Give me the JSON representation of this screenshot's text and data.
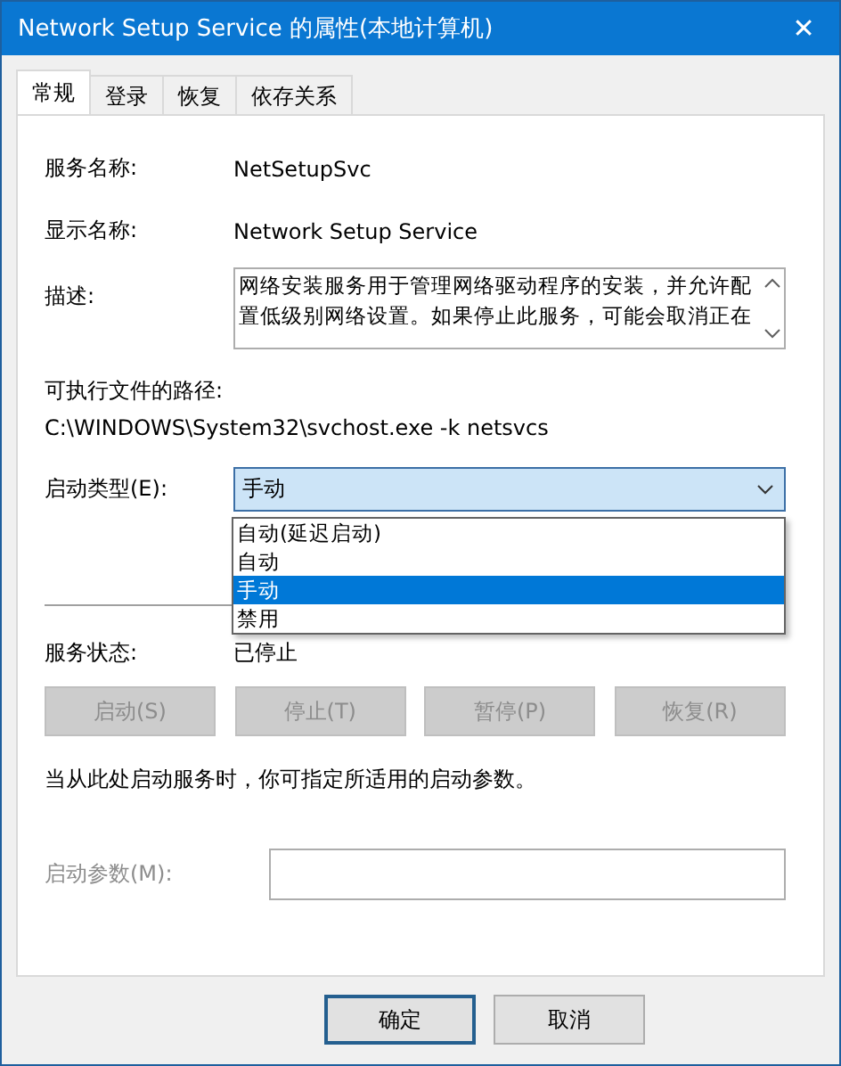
{
  "window": {
    "title": "Network Setup Service 的属性(本地计算机)",
    "close": "✕"
  },
  "tabs": [
    {
      "label": "常规",
      "selected": true
    },
    {
      "label": "登录",
      "selected": false
    },
    {
      "label": "恢复",
      "selected": false
    },
    {
      "label": "依存关系",
      "selected": false
    }
  ],
  "service_name": {
    "label": "服务名称:",
    "value": "NetSetupSvc"
  },
  "display_name": {
    "label": "显示名称:",
    "value": "Network Setup Service"
  },
  "description": {
    "label": "描述:",
    "value": "网络安装服务用于管理网络驱动程序的安装，并允许配置低级别网络设置。如果停止此服务，可能会取消正在"
  },
  "executable_path": {
    "label": "可执行文件的路径:",
    "value": "C:\\WINDOWS\\System32\\svchost.exe -k netsvcs"
  },
  "startup_type": {
    "label": "启动类型(E):",
    "value": "手动",
    "expanded": true,
    "options": [
      {
        "label": "自动(延迟启动)",
        "selected": false
      },
      {
        "label": "自动",
        "selected": false
      },
      {
        "label": "手动",
        "selected": true
      },
      {
        "label": "禁用",
        "selected": false
      }
    ]
  },
  "service_status": {
    "label": "服务状态:",
    "value": "已停止"
  },
  "service_buttons": [
    {
      "label": "启动(S)",
      "disabled": true
    },
    {
      "label": "停止(T)",
      "disabled": true
    },
    {
      "label": "暂停(P)",
      "disabled": true
    },
    {
      "label": "恢复(R)",
      "disabled": true
    }
  ],
  "hint": "当从此处启动服务时，你可指定所适用的启动参数。",
  "start_parameters": {
    "label": "启动参数(M):",
    "disabled": true
  },
  "dialog_buttons": [
    {
      "label": "确定",
      "focused": true
    },
    {
      "label": "取消",
      "focused": false
    }
  ]
}
